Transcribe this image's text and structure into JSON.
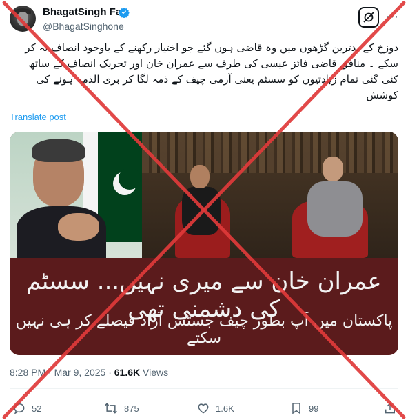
{
  "author": {
    "display_name": "BhagatSingh Fan",
    "handle": "@BhagatSinghone",
    "verified": true
  },
  "tweet": {
    "text_lines": [
      "دوزخ کے بدترین گڑھوں میں وہ قاضی ہوں گئے جو اختیار رکھنے کے باوجود انصاف نہ کر",
      "سکے ۔ منافق قاضی فائز عیسی کی طرف سے  عمران خان اور تحریک انصاف کے ساتھ",
      "کئی گئی تمام زیادتیوں کو سسٹم یعنی آرمی چیف کے ذمہ لگا کر بری الذمہ ہونے کی",
      "کوشش"
    ],
    "translate_label": "Translate post"
  },
  "media": {
    "caption_line1": "عمران خان سے میری نہیں... سسٹم کی دشمنی تھی",
    "caption_line2": "پاکستان میں آپ بطور چیف جسٹس آزاد فیصلے کر ہی نہیں سکتے"
  },
  "meta": {
    "time": "8:28 PM",
    "separator": "·",
    "date": "Mar 9, 2025",
    "views_count": "61.6K",
    "views_label": "Views"
  },
  "actions": {
    "replies": "52",
    "reposts": "875",
    "likes": "1.6K",
    "bookmarks": "99"
  },
  "colors": {
    "accent": "#1d9bf0",
    "overlay_cross": "#e03a3a",
    "media_caption_bg": "#5b1b1c"
  },
  "icons": [
    "verified-badge-icon",
    "grok-icon",
    "more-icon",
    "reply-icon",
    "repost-icon",
    "like-icon",
    "bookmark-icon",
    "share-icon"
  ]
}
